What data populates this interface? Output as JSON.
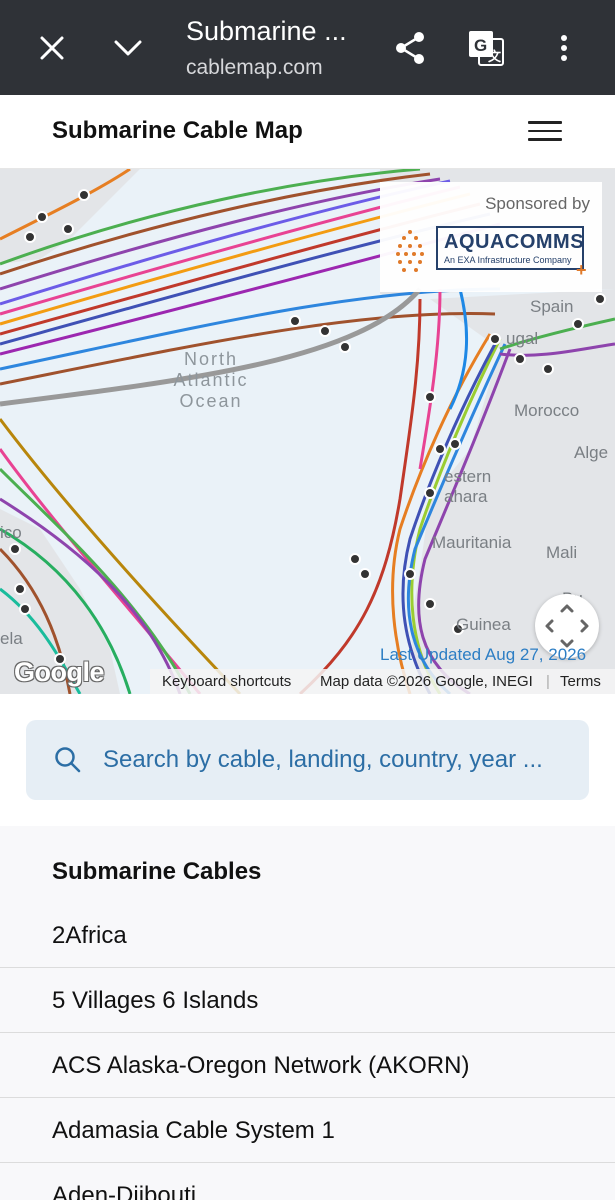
{
  "browser": {
    "title": "Submarine ...",
    "url": "cablemap.com",
    "icons": [
      "close-icon",
      "chevron-down-icon",
      "share-icon",
      "translate-icon",
      "more-vert-icon"
    ]
  },
  "header": {
    "title": "Submarine Cable Map",
    "menu_icon": "hamburger-icon"
  },
  "map": {
    "ocean_label_line1": "North",
    "ocean_label_line2": "Atlantic",
    "ocean_label_line3": "Ocean",
    "countries": [
      "Spain",
      "ugal",
      "Morocco",
      "Alge",
      "estern",
      "ahara",
      "Mauritania",
      "Mali",
      "Bu",
      "Guinea",
      "ico",
      "ela"
    ],
    "sponsor": {
      "label": "Sponsored by",
      "brand": "AQUACOMMS",
      "tagline": "An EXA Infrastructure Company",
      "plus": "+"
    },
    "last_updated": "Last Updated Aug 27, 2026",
    "google": "Google",
    "attribution": {
      "keyboard": "Keyboard shortcuts",
      "mapdata": "Map data ©2026 Google, INEGI",
      "separator": "|",
      "terms": "Terms"
    }
  },
  "search": {
    "placeholder": "Search by cable, landing, country, year ..."
  },
  "cables": {
    "heading": "Submarine Cables",
    "items": [
      "2Africa",
      "5 Villages 6 Islands",
      "ACS Alaska-Oregon Network (AKORN)",
      "Adamasia Cable System 1",
      "Aden-Djibouti"
    ]
  },
  "colors": {
    "toolbar": "#2f3237",
    "accent": "#2c6ea5",
    "search_bg": "#e6eef5",
    "list_bg": "#f8f8fa"
  }
}
